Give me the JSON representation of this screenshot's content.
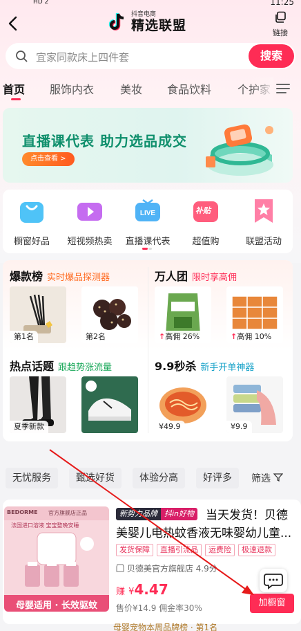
{
  "status": {
    "hd": "HD 2",
    "time": "11:25"
  },
  "header": {
    "brand_small": "抖音电商",
    "brand_big": "精选联盟",
    "link_label": "链接"
  },
  "search": {
    "placeholder": "宜家同款床上四件套",
    "button": "搜索"
  },
  "tabs": [
    "首页",
    "服饰内衣",
    "美妆",
    "食品饮料",
    "个护家"
  ],
  "banner": {
    "title": "直播课代表 助力选品成交",
    "cta": "点击查看 >"
  },
  "quick_icons": [
    {
      "label": "橱窗好品",
      "icon": "store-bag-icon"
    },
    {
      "label": "短视频热卖",
      "icon": "video-play-icon"
    },
    {
      "label": "直播课代表",
      "icon": "live-tv-icon"
    },
    {
      "label": "超值购",
      "icon": "subsidy-icon",
      "badge": "补贴"
    },
    {
      "label": "联盟活动",
      "icon": "star-ribbon-icon"
    }
  ],
  "sections": {
    "hot_list": {
      "title": "爆款榜",
      "subtitle": "实时爆品探测器",
      "items": [
        {
          "tag": "第1名"
        },
        {
          "tag": "第2名"
        }
      ]
    },
    "group_buy": {
      "title": "万人团",
      "subtitle": "限时享高佣",
      "items": [
        {
          "tag": "高佣 26%"
        },
        {
          "tag": "高佣 10%"
        }
      ]
    },
    "hot_topics": {
      "title": "热点话题",
      "subtitle": "跟趋势涨流量",
      "items": [
        {
          "tag": "夏季新款"
        },
        {
          "tag": ""
        }
      ]
    },
    "nine_nine": {
      "title": "9.9秒杀",
      "subtitle": "新手开单神器",
      "items": [
        {
          "tag": "¥49.9"
        },
        {
          "tag": "¥9.9"
        }
      ]
    }
  },
  "filters": {
    "chips": [
      "无忧服务",
      "甄选好货",
      "体验分高",
      "好评多"
    ],
    "filter_label": "筛选"
  },
  "product": {
    "badge1": "新势力品牌",
    "badge2": "抖in好物",
    "title": "当天发货！贝德美婴儿电热蚊香液无味婴幼儿童...",
    "services": [
      "发货保障",
      "直播引流品",
      "运费险",
      "极速退款"
    ],
    "shop": "贝德美官方旗舰店 4.9分",
    "price_label": "赚",
    "price_currency": "¥",
    "price_value": "4.47",
    "sub": "售价¥14.9  佣金率30%",
    "add_button": "加橱窗",
    "thumb_brand": "BEDORME",
    "thumb_store": "官方旗舰店正品",
    "thumb_caption": "母婴适用 · 长效驱蚊",
    "thumb_line": "法国进口溶液 宝宝整晚安睡"
  },
  "next_hint": "母婴宠物本周品牌榜 · 第1名",
  "colors": {
    "accent": "#fe2c55",
    "green": "#0f8f6c",
    "orange": "#ff6a1f"
  }
}
